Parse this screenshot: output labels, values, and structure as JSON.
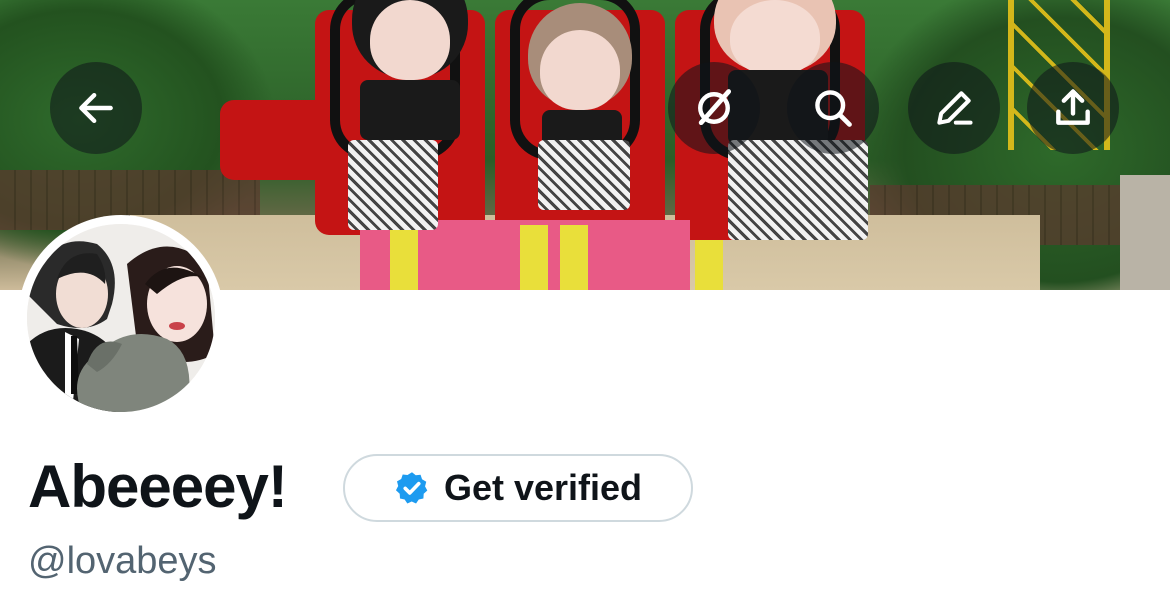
{
  "profile": {
    "display_name": "Abeeeey!",
    "handle": "@lovabeys"
  },
  "actions": {
    "get_verified_label": "Get verified"
  },
  "icons": {
    "back": "arrow-left-icon",
    "hide": "eye-slash-icon",
    "search": "search-icon",
    "edit": "pencil-icon",
    "share": "share-icon",
    "verified": "verified-badge-icon"
  },
  "colors": {
    "verified_blue": "#1d9bf0",
    "text_primary": "#0f1419",
    "text_secondary": "#536471",
    "button_border": "#cfd9de"
  }
}
